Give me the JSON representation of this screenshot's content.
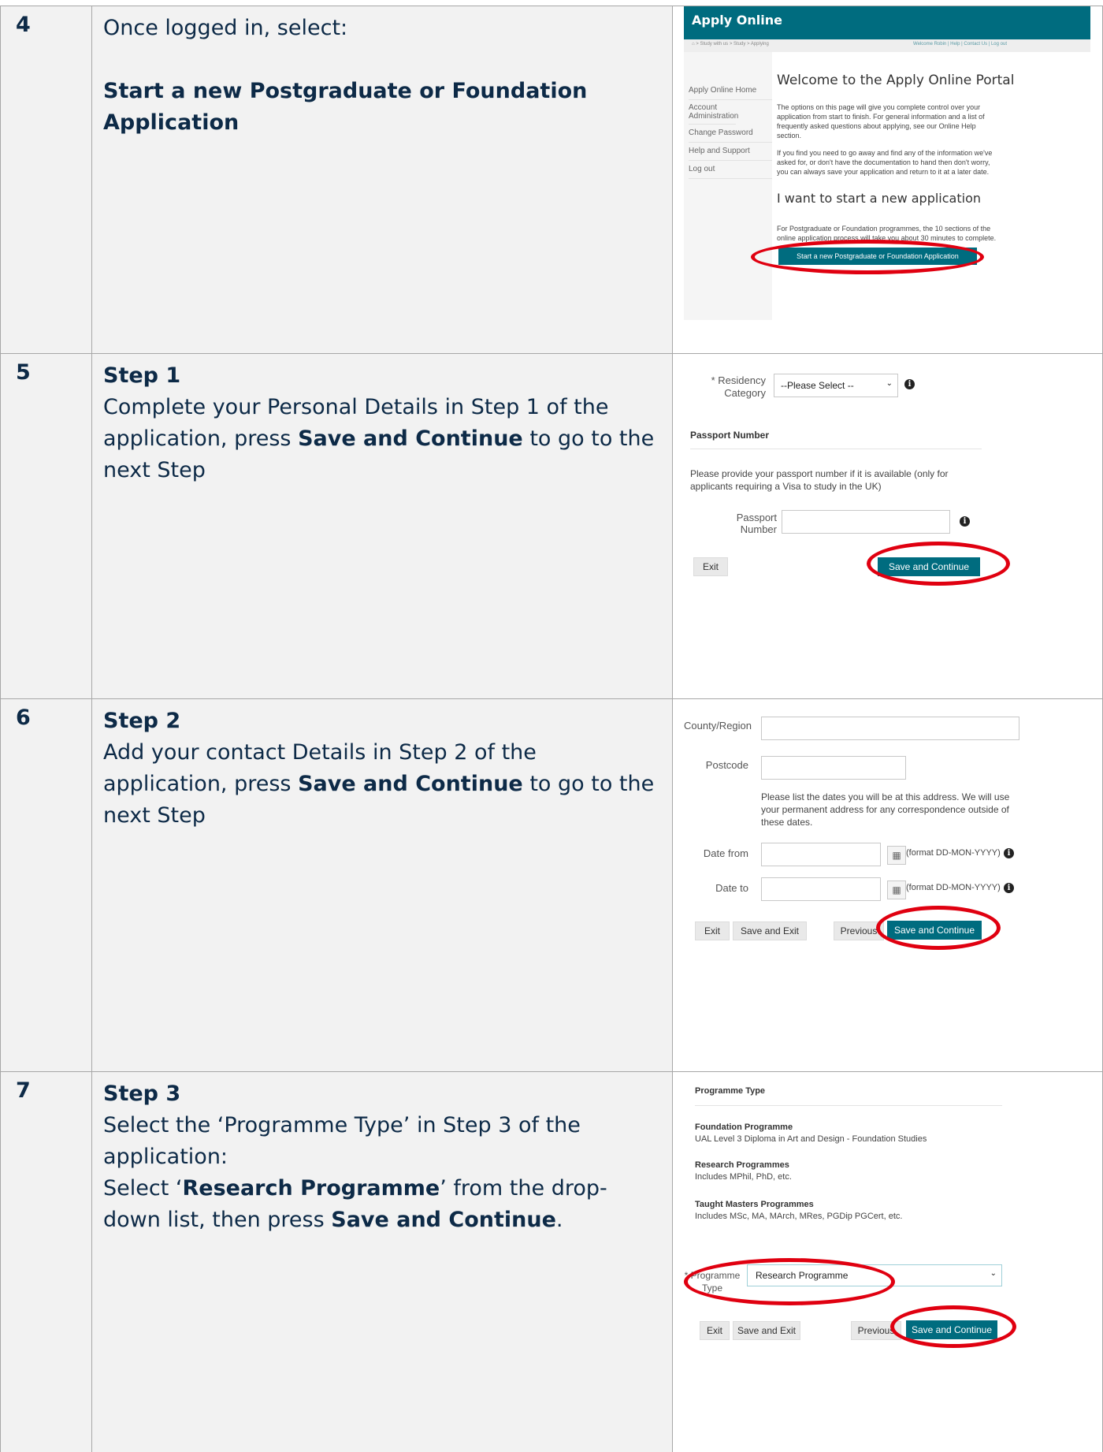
{
  "rows": [
    {
      "number": "4",
      "lead": "Once logged in, select:",
      "bold_line": "Start a new Postgraduate or Foundation Application"
    },
    {
      "number": "5",
      "heading": "Step 1",
      "text_pre": "Complete your Personal Details in Step 1 of the application, press ",
      "text_bold": "Save and Continue",
      "text_post": " to go to the next Step"
    },
    {
      "number": "6",
      "heading": "Step 2",
      "text_pre": "Add your contact Details in Step 2 of the application, press ",
      "text_bold": "Save and Continue",
      "text_post": " to go to the next Step"
    },
    {
      "number": "7",
      "heading": "Step 3",
      "line1": "Select the ‘Programme Type’ in Step 3 of the application:",
      "line2_pre": "Select ‘",
      "line2_bold": "Research Programme",
      "line2_post": "’ from the drop-down list, then press ",
      "line2_bold2": "Save and Continue",
      "line2_end": "."
    }
  ],
  "portal": {
    "header": "Apply Online",
    "breadcrumb": "⌂  >  Study with us  >  Study  >  Applying",
    "welcome_links": "Welcome Robin | Help | Contact Us | Log out",
    "menu": [
      "Apply Online Home",
      "Account Administration",
      "Change Password",
      "Help and Support",
      "Log out"
    ],
    "title": "Welcome to the Apply Online Portal",
    "para1": "The options on this page will give you complete control over your application from start to finish. For general information and a list of frequently asked questions about applying, see our Online Help section.",
    "para2": "If you find you need to go away and find any of the information we've asked for, or don't have the documentation to hand then don't worry, you can always save your application and return to it at a later date.",
    "subtitle": "I want to start a new application",
    "para3": "For Postgraduate or Foundation programmes, the 10 sections of the online application process will take you about 30 minutes to complete.",
    "start_button": "Start a new Postgraduate or Foundation Application"
  },
  "step1": {
    "residency_label": "* Residency Category",
    "residency_value": "--Please Select --",
    "passport_heading": "Passport Number",
    "passport_note": "Please provide your passport number if it is available (only for applicants requiring a Visa to study in the UK)",
    "passport_label": "Passport Number",
    "exit": "Exit",
    "save_continue": "Save and Continue"
  },
  "step2": {
    "county_label": "County/Region",
    "postcode_label": "Postcode",
    "dates_note": "Please list the dates you will be at this address. We will use your permanent address for any correspondence outside of these dates.",
    "date_from_label": "Date from",
    "date_to_label": "Date to",
    "format_hint": "(format DD-MON-YYYY)",
    "exit": "Exit",
    "save_exit": "Save and Exit",
    "previous": "Previous",
    "save_continue": "Save and Continue"
  },
  "step3": {
    "heading": "Programme Type",
    "foundation_title": "Foundation Programme",
    "foundation_desc": "UAL Level 3 Diploma in Art and Design - Foundation Studies",
    "research_title": "Research Programmes",
    "research_desc": "Includes MPhil, PhD, etc.",
    "taught_title": "Taught Masters Programmes",
    "taught_desc": "Includes MSc, MA, MArch, MRes, PGDip PGCert, etc.",
    "type_label": "* Programme Type",
    "type_value": "Research Programme",
    "exit": "Exit",
    "save_exit": "Save and Exit",
    "previous": "Previous",
    "save_continue": "Save and Continue"
  },
  "colors": {
    "accent": "#006c7f",
    "ink": "#0d2a47",
    "highlight": "#e00010"
  }
}
